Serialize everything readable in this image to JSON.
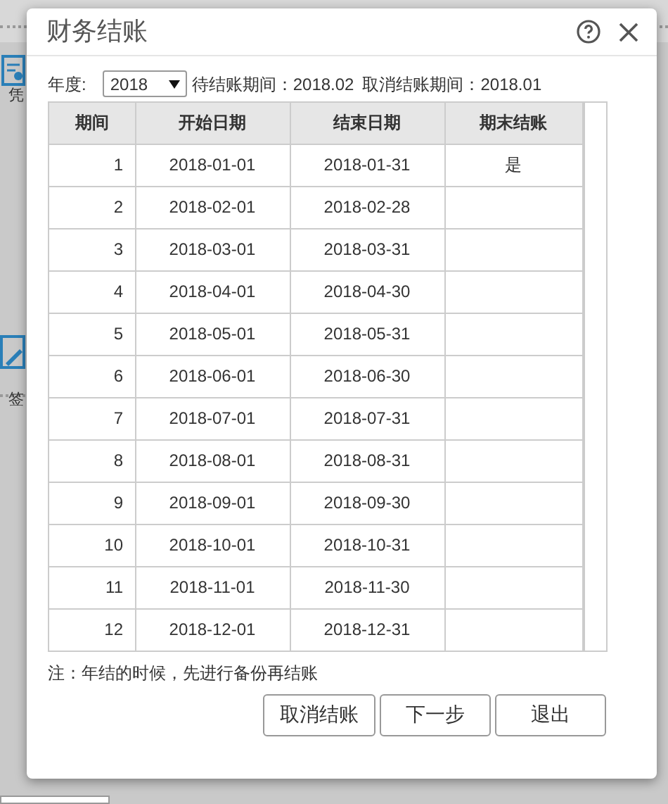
{
  "background": {
    "labels": [
      "凭",
      "签"
    ]
  },
  "dialog": {
    "title": "财务结账",
    "year_label": "年度:",
    "year": "2018",
    "pending_period": "待结账期间：2018.02",
    "cancel_period": "取消结账期间：2018.01",
    "table": {
      "columns": [
        "期间",
        "开始日期",
        "结束日期",
        "期末结账"
      ],
      "rows": [
        [
          "1",
          "2018-01-01",
          "2018-01-31",
          "是"
        ],
        [
          "2",
          "2018-02-01",
          "2018-02-28",
          ""
        ],
        [
          "3",
          "2018-03-01",
          "2018-03-31",
          ""
        ],
        [
          "4",
          "2018-04-01",
          "2018-04-30",
          ""
        ],
        [
          "5",
          "2018-05-01",
          "2018-05-31",
          ""
        ],
        [
          "6",
          "2018-06-01",
          "2018-06-30",
          ""
        ],
        [
          "7",
          "2018-07-01",
          "2018-07-31",
          ""
        ],
        [
          "8",
          "2018-08-01",
          "2018-08-31",
          ""
        ],
        [
          "9",
          "2018-09-01",
          "2018-09-30",
          ""
        ],
        [
          "10",
          "2018-10-01",
          "2018-10-31",
          ""
        ],
        [
          "11",
          "2018-11-01",
          "2018-11-30",
          ""
        ],
        [
          "12",
          "2018-12-01",
          "2018-12-31",
          ""
        ]
      ]
    },
    "note": "注：年结的时候，先进行备份再结账",
    "buttons": [
      "取消结账",
      "下一步",
      "退出"
    ]
  }
}
